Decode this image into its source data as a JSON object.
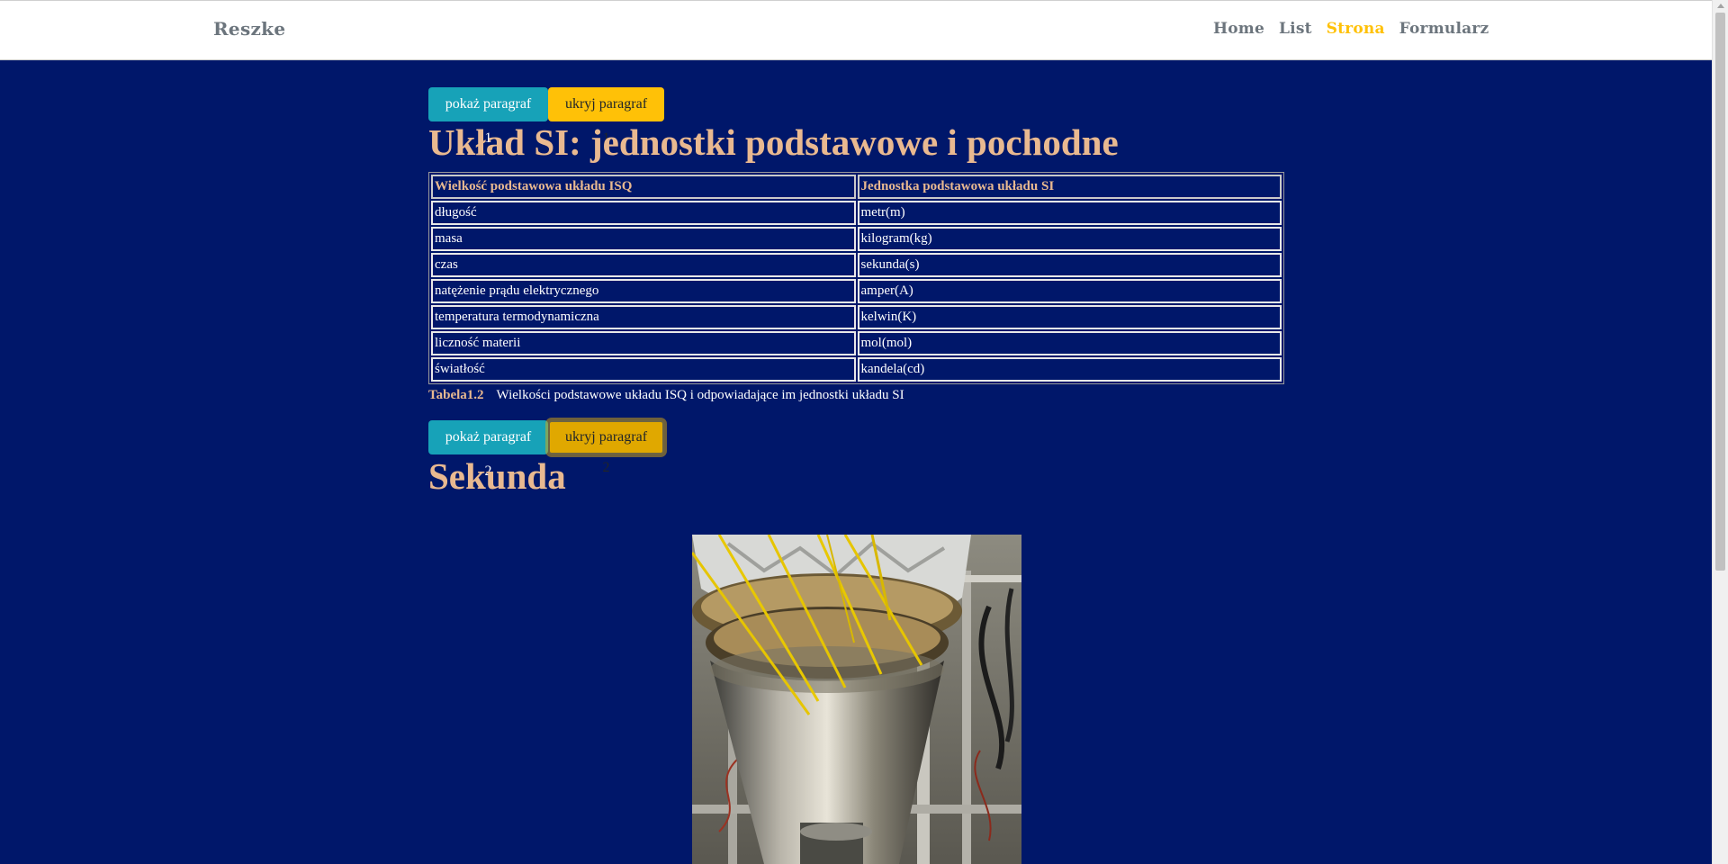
{
  "nav": {
    "brand": "Reszke",
    "links": [
      "Home",
      "List",
      "Strona",
      "Formularz"
    ],
    "active": "Strona"
  },
  "section1": {
    "show_label": "pokaż paragraf 1",
    "hide_label": "ukryj paragraf 1",
    "title": "Układ SI: jednostki podstawowe i pochodne",
    "table": {
      "headers": [
        "Wielkość podstawowa układu ISQ",
        "Jednostka podstawowa układu SI"
      ],
      "rows": [
        [
          "długość",
          "metr(m)"
        ],
        [
          "masa",
          "kilogram(kg)"
        ],
        [
          "czas",
          "sekunda(s)"
        ],
        [
          "natężenie prądu elektrycznego",
          "amper(A)"
        ],
        [
          "temperatura termodynamiczna",
          "kelwin(K)"
        ],
        [
          "liczność materii",
          "mol(mol)"
        ],
        [
          "światłość",
          "kandela(cd)"
        ]
      ]
    },
    "caption_label": "Tabela1.2",
    "caption_text": "Wielkości podstawowe układu ISQ i odpowiadające im jednostki układu SI"
  },
  "section2": {
    "show_label": "pokaż paragraf 2",
    "hide_label": "ukryj paragraf 2",
    "title": "Sekunda"
  },
  "colors": {
    "background": "#00176a",
    "heading": "#e9b990",
    "info_button": "#17a2b8",
    "warning_button": "#ffc107",
    "nav_active": "#ffc107",
    "nav_text": "#6c757d"
  }
}
